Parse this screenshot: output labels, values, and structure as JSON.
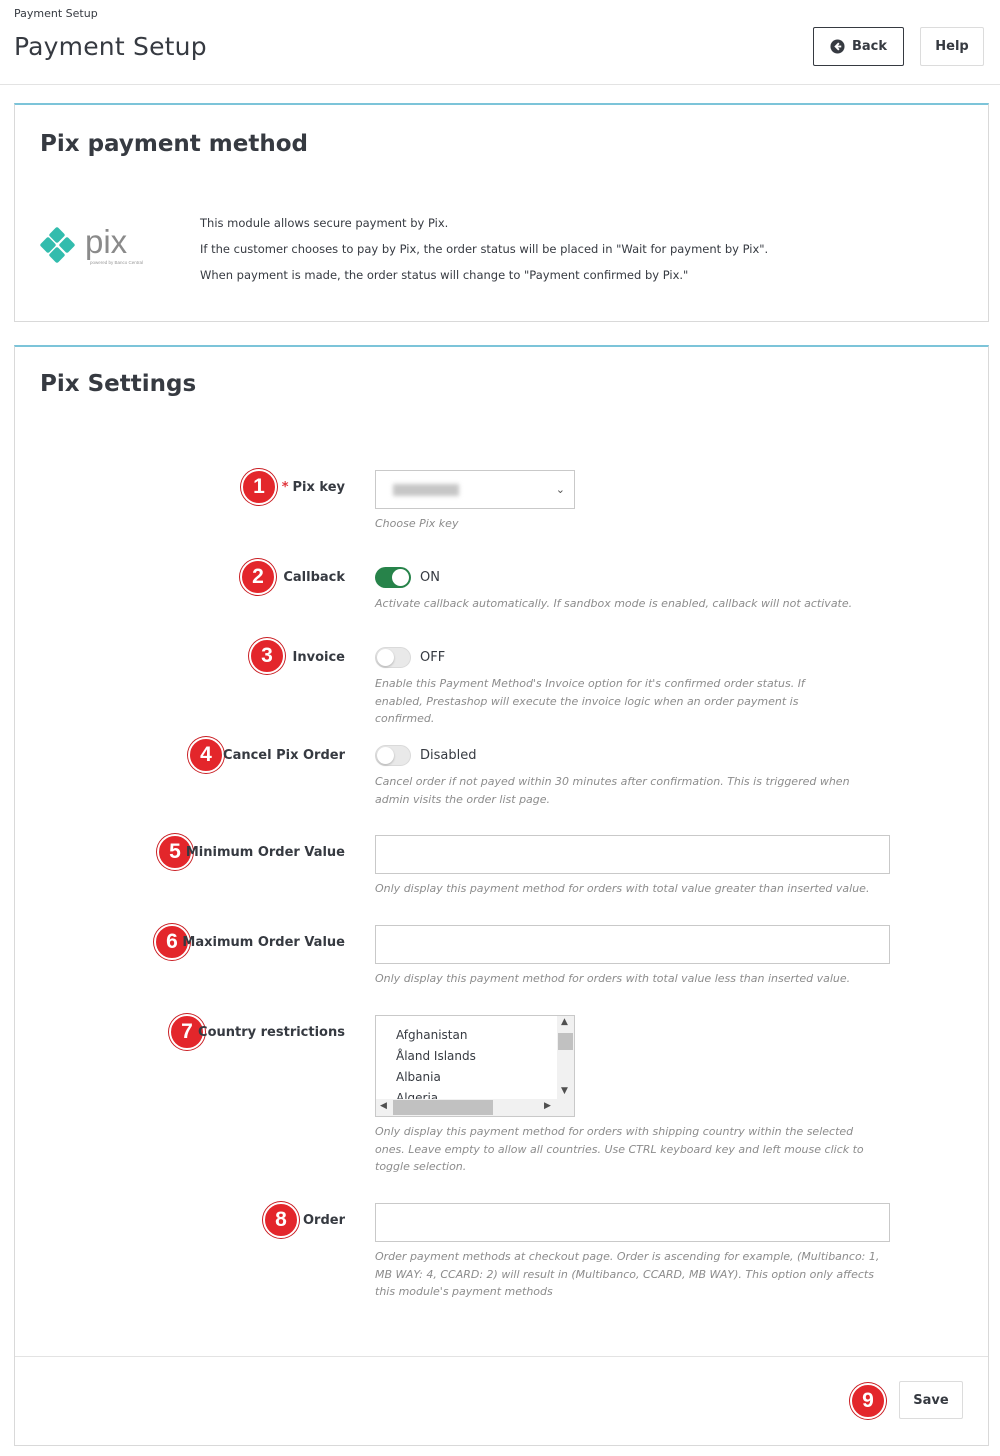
{
  "breadcrumb": "Payment Setup",
  "page_title": "Payment Setup",
  "toolbar": {
    "back_label": "Back",
    "help_label": "Help"
  },
  "info_panel": {
    "title": "Pix payment method",
    "logo_text": "pix",
    "logo_subtext": "powered by Banco Central",
    "lines": [
      "This module allows secure payment by Pix.",
      "If the customer chooses to pay by Pix, the order status will be placed in \"Wait for payment by Pix\".",
      "When payment is made, the order status will change to \"Payment confirmed by Pix.\""
    ]
  },
  "settings": {
    "title": "Pix Settings",
    "pix_key": {
      "label": "Pix key",
      "required_mark": "*",
      "help": "Choose Pix key",
      "badge": "1"
    },
    "callback": {
      "label": "Callback",
      "state": "ON",
      "help": "Activate callback automatically. If sandbox mode is enabled, callback will not activate.",
      "badge": "2"
    },
    "invoice": {
      "label": "Invoice",
      "state": "OFF",
      "help": "Enable this Payment Method's Invoice option for it's confirmed order status. If enabled, Prestashop will execute the invoice logic when an order payment is confirmed.",
      "badge": "3"
    },
    "cancel": {
      "label": "Cancel Pix Order",
      "state": "Disabled",
      "help": "Cancel order if not payed within 30 minutes after confirmation. This is triggered when admin visits the order list page.",
      "badge": "4"
    },
    "min_value": {
      "label": "Minimum Order Value",
      "value": "",
      "help": "Only display this payment method for orders with total value greater than inserted value.",
      "badge": "5"
    },
    "max_value": {
      "label": "Maximum Order Value",
      "value": "",
      "help": "Only display this payment method for orders with total value less than inserted value.",
      "badge": "6"
    },
    "countries": {
      "label": "Country restrictions",
      "options": [
        "Afghanistan",
        "Åland Islands",
        "Albania",
        "Algeria"
      ],
      "help": "Only display this payment method for orders with shipping country within the selected ones. Leave empty to allow all countries. Use CTRL keyboard key and left mouse click to toggle selection.",
      "badge": "7"
    },
    "order": {
      "label": "Order",
      "value": "",
      "help": "Order payment methods at checkout page. Order is ascending for example, (Multibanco: 1, MB WAY: 4, CCARD: 2) will result in (Multibanco, CCARD, MB WAY). This option only affects this module's payment methods",
      "badge": "8"
    },
    "save_label": "Save",
    "save_badge": "9"
  },
  "colors": {
    "accent": "#7cc4d9",
    "badge": "#e3262b",
    "switch_on": "#27834a",
    "pix_teal": "#32bcad"
  }
}
